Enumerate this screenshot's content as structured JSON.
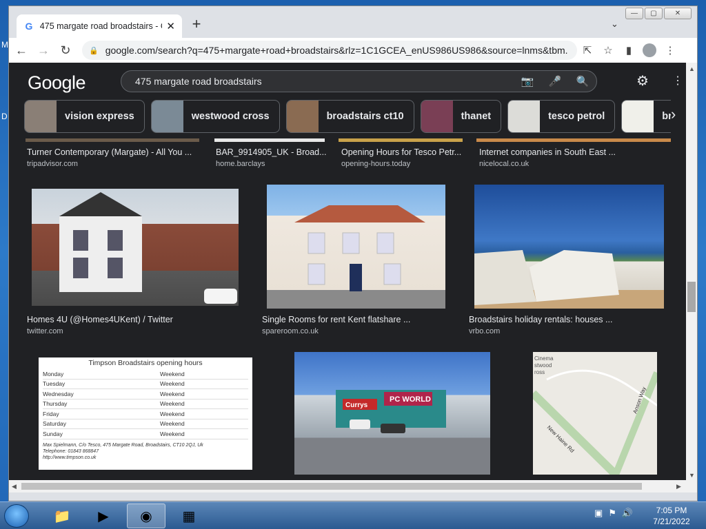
{
  "desktop": {
    "letters": [
      "M",
      "D"
    ]
  },
  "window": {
    "tab_title": "475 margate road broadstairs - G",
    "tab_close": "✕",
    "new_tab": "+",
    "tab_search": "⌄",
    "minimize": "—",
    "maximize": "▢",
    "close": "✕"
  },
  "toolbar": {
    "back": "←",
    "forward": "→",
    "reload": "↻",
    "url": "google.com/search?q=475+margate+road+broadstairs&rlz=1C1GCEA_enUS986US986&source=lnms&tbm...",
    "share": "⇱",
    "star": "☆",
    "sidebar": "▮",
    "menu": "⋮"
  },
  "google": {
    "logo": "Google",
    "query": "475 margate road broadstairs",
    "settings": "⚙",
    "apps": "⋮⋮⋮",
    "chips": [
      {
        "label": "vision express",
        "color": "#8a7f76"
      },
      {
        "label": "westwood cross",
        "color": "#7b8a96"
      },
      {
        "label": "broadstairs ct10",
        "color": "#8a6b52"
      },
      {
        "label": "thanet",
        "color": "#7a3f55"
      },
      {
        "label": "tesco petrol",
        "color": "#dcdcd8"
      },
      {
        "label": "bro",
        "color": "#f0f0ea"
      }
    ],
    "chip_next": "›"
  },
  "results": {
    "row1": [
      {
        "title": "Turner Contemporary (Margate) - All You ...",
        "source": "tripadvisor.com"
      },
      {
        "title": "BAR_9914905_UK - Broad...",
        "source": "home.barclays"
      },
      {
        "title": "Opening Hours for Tesco Petr...",
        "source": "opening-hours.today"
      },
      {
        "title": "Internet companies in South East ...",
        "source": "nicelocal.co.uk"
      }
    ],
    "row2": [
      {
        "title": "Homes 4U (@Homes4UKent) / Twitter",
        "source": "twitter.com"
      },
      {
        "title": "Single Rooms for rent Kent flatshare ...",
        "source": "spareroom.co.uk"
      },
      {
        "title": "Broadstairs holiday rentals: houses ...",
        "source": "vrbo.com"
      }
    ],
    "timpson": {
      "heading": "Timpson Broadstairs opening hours",
      "rows": [
        {
          "day": "Monday",
          "hours": "Weekend"
        },
        {
          "day": "Tuesday",
          "hours": "Weekend"
        },
        {
          "day": "Wednesday",
          "hours": "Weekend"
        },
        {
          "day": "Thursday",
          "hours": "Weekend"
        },
        {
          "day": "Friday",
          "hours": "Weekend"
        },
        {
          "day": "Saturday",
          "hours": "Weekend"
        },
        {
          "day": "Sunday",
          "hours": "Weekend"
        }
      ],
      "address": "Max Spielmann, C/o Tesco, 475 Margate Road, Broadstairs, CT10 2QJ, Uk",
      "phone": "Telephone: 01843 868847",
      "web": "http://www.timpson.co.uk"
    },
    "shop_signs": {
      "sign1": "Currys",
      "sign2": "PC WORLD"
    },
    "map": {
      "label1": "Cinema",
      "label2": "stwood",
      "label3": "ross",
      "road1": "New Haine Rd",
      "road2": "Anson Way"
    }
  },
  "taskbar": {
    "time": "7:05 PM",
    "date": "7/21/2022"
  }
}
